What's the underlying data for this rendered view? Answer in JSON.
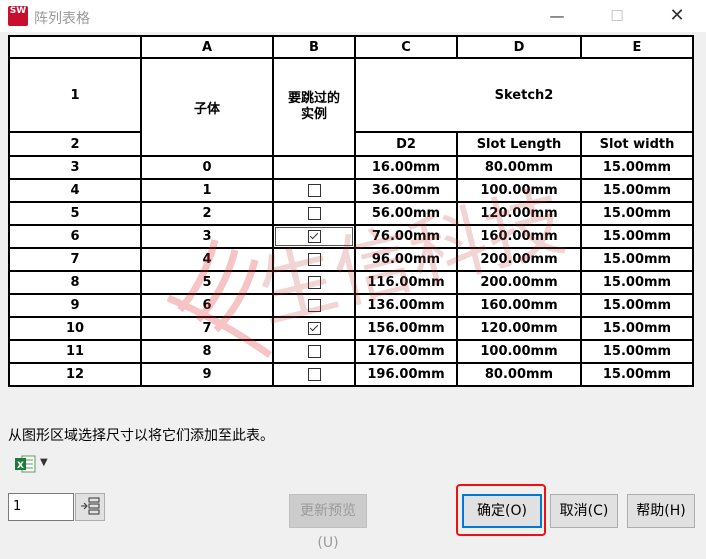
{
  "window": {
    "app_icon_text": "SW",
    "title": "阵列表格",
    "minimize": "—",
    "maximize": "☐",
    "close": "✕"
  },
  "table": {
    "column_letters": [
      "A",
      "B",
      "C",
      "D",
      "E"
    ],
    "header_row_numbers": [
      "1",
      "2"
    ],
    "header": {
      "a": "子体",
      "b": "要跳过的\n实例",
      "cde": "Sketch2",
      "c": "D2",
      "d": "Slot Length",
      "e": "Slot width"
    },
    "rows": [
      {
        "num": "3",
        "a": "0",
        "checked": null,
        "c": "16.00mm",
        "d": "80.00mm",
        "e": "15.00mm",
        "gray": true
      },
      {
        "num": "4",
        "a": "1",
        "checked": false,
        "c": "36.00mm",
        "d": "100.00mm",
        "e": "15.00mm"
      },
      {
        "num": "5",
        "a": "2",
        "checked": false,
        "c": "56.00mm",
        "d": "120.00mm",
        "e": "15.00mm"
      },
      {
        "num": "6",
        "a": "3",
        "checked": true,
        "c": "76.00mm",
        "d": "160.00mm",
        "e": "15.00mm",
        "selected": true
      },
      {
        "num": "7",
        "a": "4",
        "checked": false,
        "c": "96.00mm",
        "d": "200.00mm",
        "e": "15.00mm"
      },
      {
        "num": "8",
        "a": "5",
        "checked": false,
        "c": "116.00mm",
        "d": "200.00mm",
        "e": "15.00mm"
      },
      {
        "num": "9",
        "a": "6",
        "checked": false,
        "c": "136.00mm",
        "d": "160.00mm",
        "e": "15.00mm"
      },
      {
        "num": "10",
        "a": "7",
        "checked": true,
        "c": "156.00mm",
        "d": "120.00mm",
        "e": "15.00mm"
      },
      {
        "num": "11",
        "a": "8",
        "checked": false,
        "c": "176.00mm",
        "d": "100.00mm",
        "e": "15.00mm"
      },
      {
        "num": "12",
        "a": "9",
        "checked": false,
        "c": "196.00mm",
        "d": "80.00mm",
        "e": "15.00mm"
      }
    ]
  },
  "watermark_text": "生信科技",
  "hint": "从图形区域选择尺寸以将它们添加至此表。",
  "excel_icon": "excel-icon",
  "count_value": "1",
  "buttons": {
    "preview": "更新预览(U)",
    "ok": "确定(O)",
    "cancel": "取消(C)",
    "help": "帮助(H)"
  },
  "colors": {
    "highlight": "#e11111",
    "focus": "#0078d7",
    "disabled_text": "#9a9a9a"
  }
}
